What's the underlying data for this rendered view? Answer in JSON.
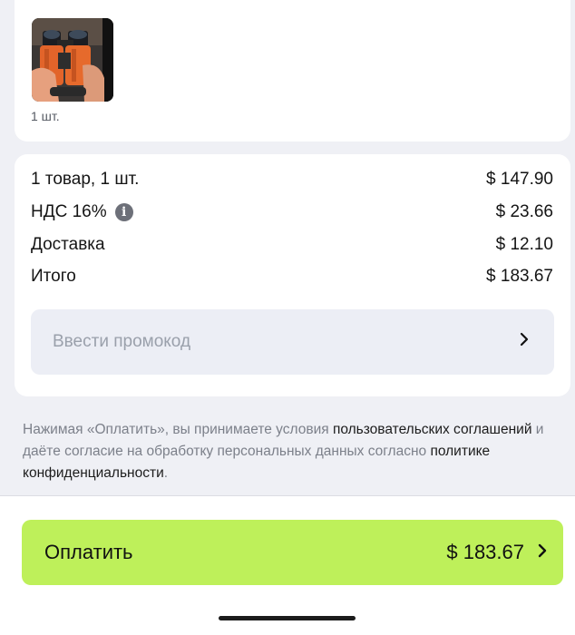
{
  "product": {
    "image_icon": "binoculars-photo",
    "quantity": "1 шт."
  },
  "summary": {
    "items_label": "1 товар, 1 шт.",
    "items_value": "$ 147.90",
    "vat_label": "НДС 16%",
    "vat_info_icon": "info-icon",
    "vat_value": "$ 23.66",
    "delivery_label": "Доставка",
    "delivery_value": "$ 12.10",
    "total_label": "Итого",
    "total_value": "$ 183.67"
  },
  "promo": {
    "placeholder": "Ввести промокод",
    "chevron_icon": "chevron-right-icon"
  },
  "legal": {
    "part1": "Нажимая «Оплатить», вы принимаете условия ",
    "link1": "пользовательских соглашений",
    "part2": " и даёте согласие на обработку персональных данных согласно ",
    "link2": "политике конфиденциальности",
    "part3": "."
  },
  "pay": {
    "label": "Оплатить",
    "amount": "$ 183.67",
    "chevron_icon": "chevron-right-icon"
  },
  "colors": {
    "pay_button": "#bef05a",
    "background": "#eff0f5",
    "card": "#ffffff",
    "promo_field": "#eceef5"
  }
}
